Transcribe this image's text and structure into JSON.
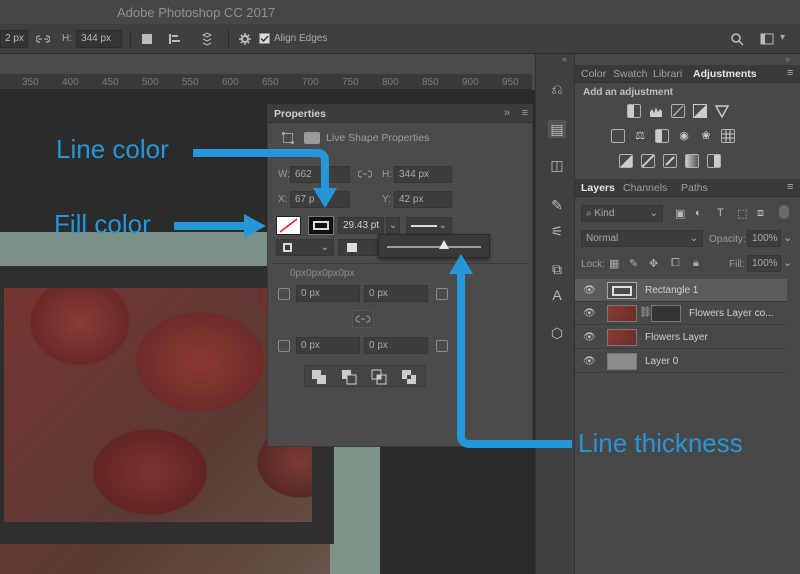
{
  "app": {
    "title": "Adobe Photoshop CC 2017"
  },
  "options_bar": {
    "width_value": "2 px",
    "h_label": "H:",
    "h_value": "344 px",
    "align_edges_label": "Align Edges"
  },
  "ruler": {
    "ticks": [
      "350",
      "400",
      "450",
      "500",
      "550",
      "600",
      "650",
      "700",
      "750",
      "800",
      "850",
      "900",
      "950"
    ]
  },
  "properties": {
    "title": "Properties",
    "subtitle": "Live Shape Properties",
    "w_label": "W:",
    "w_value": "662",
    "h_label": "H:",
    "h_value": "344 px",
    "x_label": "X:",
    "x_value": "67 p",
    "y_label": "Y:",
    "y_value": "42 px",
    "stroke_width": "29.43 pt",
    "corner_radius": "0px0px0px0px",
    "corner_tl": "0 px",
    "corner_tr": "0 px",
    "corner_bl": "0 px",
    "corner_br": "0 px"
  },
  "adjustments_panel": {
    "tabs": [
      "Color",
      "Swatch",
      "Librari",
      "Adjustments"
    ],
    "active_tab": "Adjustments",
    "heading": "Add an adjustment"
  },
  "layers_panel": {
    "tabs": [
      "Layers",
      "Channels",
      "Paths"
    ],
    "active_tab": "Layers",
    "filter_value": "Kind",
    "blend_mode": "Normal",
    "opacity_label": "Opacity:",
    "opacity_value": "100%",
    "lock_label": "Lock:",
    "fill_label": "Fill:",
    "fill_value": "100%",
    "layers": [
      {
        "name": "Rectangle 1",
        "selected": true
      },
      {
        "name": "Flowers Layer co...",
        "selected": false
      },
      {
        "name": "Flowers Layer",
        "selected": false
      },
      {
        "name": "Layer 0",
        "selected": false
      }
    ]
  },
  "annotations": {
    "line_color": "Line color",
    "fill_color": "Fill color",
    "line_thickness": "Line thickness"
  },
  "colors": {
    "annotation": "#2596d8",
    "panel_bg": "#484848",
    "selected_row": "#5b5b5b"
  }
}
